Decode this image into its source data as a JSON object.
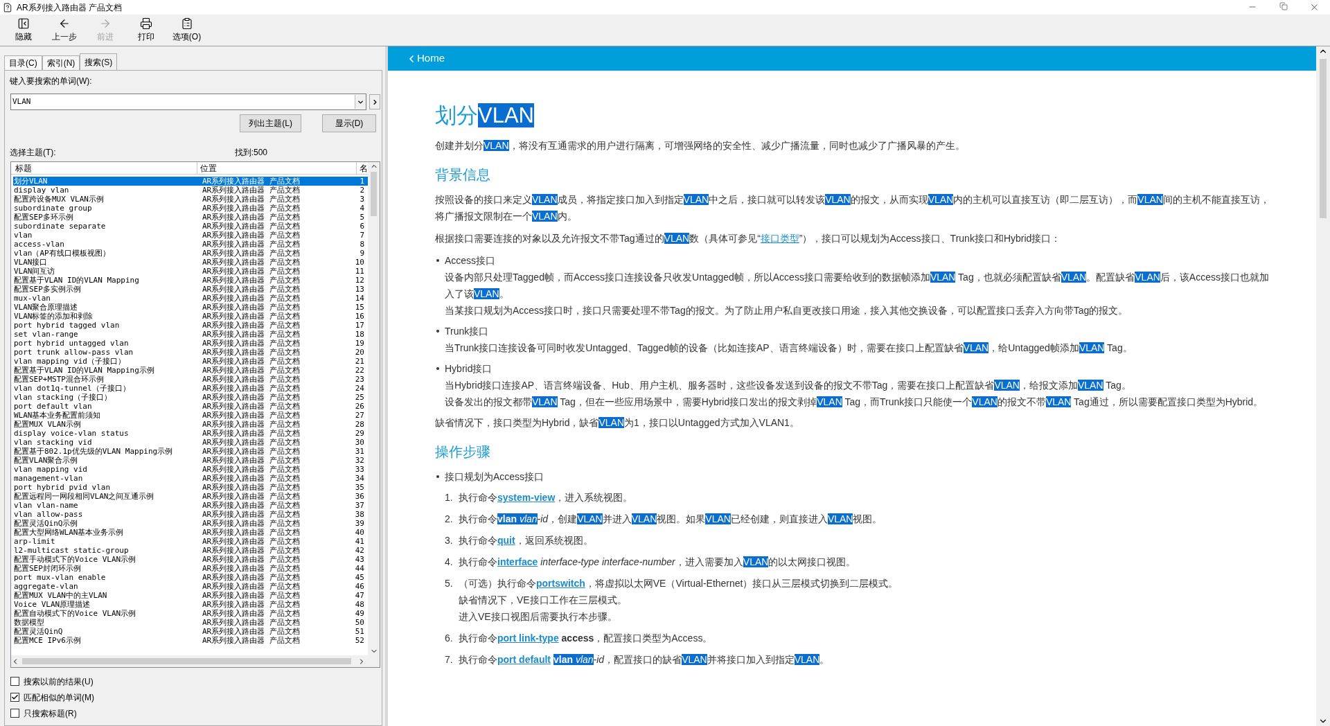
{
  "window": {
    "title": "AR系列接入路由器 产品文档"
  },
  "toolbar": [
    {
      "kind": "hide",
      "label": "隐藏",
      "disabled": false
    },
    {
      "kind": "back",
      "label": "上一步",
      "disabled": false
    },
    {
      "kind": "forward",
      "label": "前进",
      "disabled": true
    },
    {
      "kind": "print",
      "label": "打印",
      "disabled": false
    },
    {
      "kind": "options",
      "label": "选项(O)",
      "disabled": false
    }
  ],
  "tabs": [
    {
      "label": "目录(C)",
      "selected": false
    },
    {
      "label": "索引(N)",
      "selected": false
    },
    {
      "label": "搜索(S)",
      "selected": true
    }
  ],
  "search": {
    "label": "键入要搜索的单词(W):",
    "value": "VLAN"
  },
  "buttons": [
    "列出主题(L)",
    "显示(D)"
  ],
  "topics": {
    "label": "选择主题(T):",
    "found": "找到:500",
    "columns": [
      "标题",
      "位置",
      "名"
    ],
    "rows": [
      {
        "title": "划分VLAN",
        "location": "AR系列接入路由器 产品文档",
        "rank": "1",
        "selected": true
      },
      {
        "title": "display vlan",
        "location": "AR系列接入路由器 产品文档",
        "rank": "2",
        "selected": false
      },
      {
        "title": "配置跨设备MUX VLAN示例",
        "location": "AR系列接入路由器 产品文档",
        "rank": "3",
        "selected": false
      },
      {
        "title": "subordinate group",
        "location": "AR系列接入路由器 产品文档",
        "rank": "4",
        "selected": false
      },
      {
        "title": "配置SEP多环示例",
        "location": "AR系列接入路由器 产品文档",
        "rank": "5",
        "selected": false
      },
      {
        "title": "subordinate separate",
        "location": "AR系列接入路由器 产品文档",
        "rank": "6",
        "selected": false
      },
      {
        "title": "vlan",
        "location": "AR系列接入路由器 产品文档",
        "rank": "7",
        "selected": false
      },
      {
        "title": "access-vlan",
        "location": "AR系列接入路由器 产品文档",
        "rank": "8",
        "selected": false
      },
      {
        "title": "vlan（AP有线口模板视图）",
        "location": "AR系列接入路由器 产品文档",
        "rank": "9",
        "selected": false
      },
      {
        "title": "VLAN接口",
        "location": "AR系列接入路由器 产品文档",
        "rank": "10",
        "selected": false
      },
      {
        "title": "VLAN间互访",
        "location": "AR系列接入路由器 产品文档",
        "rank": "11",
        "selected": false
      },
      {
        "title": "配置基于VLAN ID的VLAN Mapping",
        "location": "AR系列接入路由器 产品文档",
        "rank": "12",
        "selected": false
      },
      {
        "title": "配置SEP多实例示例",
        "location": "AR系列接入路由器 产品文档",
        "rank": "13",
        "selected": false
      },
      {
        "title": "mux-vlan",
        "location": "AR系列接入路由器 产品文档",
        "rank": "14",
        "selected": false
      },
      {
        "title": "VLAN聚合原理描述",
        "location": "AR系列接入路由器 产品文档",
        "rank": "15",
        "selected": false
      },
      {
        "title": "VLAN标签的添加和剥除",
        "location": "AR系列接入路由器 产品文档",
        "rank": "16",
        "selected": false
      },
      {
        "title": "port hybrid tagged vlan",
        "location": "AR系列接入路由器 产品文档",
        "rank": "17",
        "selected": false
      },
      {
        "title": "set vlan-range",
        "location": "AR系列接入路由器 产品文档",
        "rank": "18",
        "selected": false
      },
      {
        "title": "port hybrid untagged vlan",
        "location": "AR系列接入路由器 产品文档",
        "rank": "19",
        "selected": false
      },
      {
        "title": "port trunk allow-pass vlan",
        "location": "AR系列接入路由器 产品文档",
        "rank": "20",
        "selected": false
      },
      {
        "title": "vlan mapping vid（子接口）",
        "location": "AR系列接入路由器 产品文档",
        "rank": "21",
        "selected": false
      },
      {
        "title": "配置基于VLAN ID的VLAN Mapping示例",
        "location": "AR系列接入路由器 产品文档",
        "rank": "22",
        "selected": false
      },
      {
        "title": "配置SEP+MSTP混合环示例",
        "location": "AR系列接入路由器 产品文档",
        "rank": "23",
        "selected": false
      },
      {
        "title": "vlan dot1q-tunnel（子接口）",
        "location": "AR系列接入路由器 产品文档",
        "rank": "24",
        "selected": false
      },
      {
        "title": "vlan stacking（子接口）",
        "location": "AR系列接入路由器 产品文档",
        "rank": "25",
        "selected": false
      },
      {
        "title": "port default vlan",
        "location": "AR系列接入路由器 产品文档",
        "rank": "26",
        "selected": false
      },
      {
        "title": "WLAN基本业务配置前须知",
        "location": "AR系列接入路由器 产品文档",
        "rank": "27",
        "selected": false
      },
      {
        "title": "配置MUX VLAN示例",
        "location": "AR系列接入路由器 产品文档",
        "rank": "28",
        "selected": false
      },
      {
        "title": "display voice-vlan status",
        "location": "AR系列接入路由器 产品文档",
        "rank": "29",
        "selected": false
      },
      {
        "title": "vlan stacking vid",
        "location": "AR系列接入路由器 产品文档",
        "rank": "30",
        "selected": false
      },
      {
        "title": "配置基于802.1p优先级的VLAN Mapping示例",
        "location": "AR系列接入路由器 产品文档",
        "rank": "31",
        "selected": false
      },
      {
        "title": "配置VLAN聚合示例",
        "location": "AR系列接入路由器 产品文档",
        "rank": "32",
        "selected": false
      },
      {
        "title": "vlan mapping vid",
        "location": "AR系列接入路由器 产品文档",
        "rank": "33",
        "selected": false
      },
      {
        "title": "management-vlan",
        "location": "AR系列接入路由器 产品文档",
        "rank": "34",
        "selected": false
      },
      {
        "title": "port hybrid pvid vlan",
        "location": "AR系列接入路由器 产品文档",
        "rank": "35",
        "selected": false
      },
      {
        "title": "配置远程同一网段相同VLAN之间互通示例",
        "location": "AR系列接入路由器 产品文档",
        "rank": "36",
        "selected": false
      },
      {
        "title": "vlan vlan-name",
        "location": "AR系列接入路由器 产品文档",
        "rank": "37",
        "selected": false
      },
      {
        "title": "vlan allow-pass",
        "location": "AR系列接入路由器 产品文档",
        "rank": "38",
        "selected": false
      },
      {
        "title": "配置灵活QinQ示例",
        "location": "AR系列接入路由器 产品文档",
        "rank": "39",
        "selected": false
      },
      {
        "title": "配置大型网络WLAN基本业务示例",
        "location": "AR系列接入路由器 产品文档",
        "rank": "40",
        "selected": false
      },
      {
        "title": "arp-limit",
        "location": "AR系列接入路由器 产品文档",
        "rank": "41",
        "selected": false
      },
      {
        "title": "l2-multicast static-group",
        "location": "AR系列接入路由器 产品文档",
        "rank": "42",
        "selected": false
      },
      {
        "title": "配置手动模式下的Voice VLAN示例",
        "location": "AR系列接入路由器 产品文档",
        "rank": "43",
        "selected": false
      },
      {
        "title": "配置SEP封闭环示例",
        "location": "AR系列接入路由器 产品文档",
        "rank": "44",
        "selected": false
      },
      {
        "title": "port mux-vlan enable",
        "location": "AR系列接入路由器 产品文档",
        "rank": "45",
        "selected": false
      },
      {
        "title": "aggregate-vlan",
        "location": "AR系列接入路由器 产品文档",
        "rank": "46",
        "selected": false
      },
      {
        "title": "配置MUX VLAN中的主VLAN",
        "location": "AR系列接入路由器 产品文档",
        "rank": "47",
        "selected": false
      },
      {
        "title": "Voice VLAN原理描述",
        "location": "AR系列接入路由器 产品文档",
        "rank": "48",
        "selected": false
      },
      {
        "title": "配置自动模式下的Voice VLAN示例",
        "location": "AR系列接入路由器 产品文档",
        "rank": "49",
        "selected": false
      },
      {
        "title": "数据模型",
        "location": "AR系列接入路由器 产品文档",
        "rank": "50",
        "selected": false
      },
      {
        "title": "配置灵活QinQ",
        "location": "AR系列接入路由器 产品文档",
        "rank": "51",
        "selected": false
      },
      {
        "title": "配置MCE IPv6示例",
        "location": "AR系列接入路由器 产品文档",
        "rank": "52",
        "selected": false
      }
    ]
  },
  "options": [
    {
      "label": "搜索以前的结果(U)",
      "checked": false
    },
    {
      "label": "匹配相似的单词(M)",
      "checked": true
    },
    {
      "label": "只搜索标题(R)",
      "checked": false
    }
  ],
  "content": {
    "back": "Home",
    "title": [
      {
        "kind": "text",
        "text": "划分"
      },
      {
        "kind": "hit",
        "text": "VLAN"
      }
    ],
    "blocks": [
      {
        "kind": "p",
        "runs": [
          {
            "kind": "text",
            "text": "创建并划分"
          },
          {
            "kind": "hit",
            "text": "VLAN"
          },
          {
            "kind": "text",
            "text": "，将没有互通需求的用户进行隔离，可增强网络的安全性、减少广播流量，同时也减少了广播风暴的产生。"
          }
        ]
      },
      {
        "kind": "h2",
        "text": "背景信息"
      },
      {
        "kind": "p",
        "runs": [
          {
            "kind": "text",
            "text": "按照设备的接口来定义"
          },
          {
            "kind": "hit",
            "text": "VLAN"
          },
          {
            "kind": "text",
            "text": "成员，将指定接口加入到指定"
          },
          {
            "kind": "hit",
            "text": "VLAN"
          },
          {
            "kind": "text",
            "text": "中之后，接口就可以转发该"
          },
          {
            "kind": "hit",
            "text": "VLAN"
          },
          {
            "kind": "text",
            "text": "的报文，从而实现"
          },
          {
            "kind": "hit",
            "text": "VLAN"
          },
          {
            "kind": "text",
            "text": "内的主机可以直接互访（即二层互访），而"
          },
          {
            "kind": "hit",
            "text": "VLAN"
          },
          {
            "kind": "text",
            "text": "间的主机不能直接互访，将广播报文限制在一个"
          },
          {
            "kind": "hit",
            "text": "VLAN"
          },
          {
            "kind": "text",
            "text": "内。"
          }
        ]
      },
      {
        "kind": "p",
        "runs": [
          {
            "kind": "text",
            "text": "根据接口需要连接的对象以及允许报文不带Tag通过的"
          },
          {
            "kind": "hit",
            "text": "VLAN"
          },
          {
            "kind": "text",
            "text": "数（具体可参见“"
          },
          {
            "kind": "link",
            "text": "接口类型"
          },
          {
            "kind": "text",
            "text": "”），接口可以规划为Access接口、Trunk接口和Hybrid接口："
          }
        ]
      },
      {
        "kind": "bullet",
        "text": "Access接口",
        "lines": [
          [
            {
              "kind": "text",
              "text": "设备内部只处理Tagged帧，而Access接口连接设备只收发Untagged帧，所以Access接口需要给收到的数据帧添加"
            },
            {
              "kind": "hit",
              "text": "VLAN"
            },
            {
              "kind": "text",
              "text": " Tag，也就必须配置缺省"
            },
            {
              "kind": "hit",
              "text": "VLAN"
            },
            {
              "kind": "text",
              "text": "。配置缺省"
            },
            {
              "kind": "hit",
              "text": "VLAN"
            },
            {
              "kind": "text",
              "text": "后，该Access接口也就加入了该"
            },
            {
              "kind": "hit",
              "text": "VLAN"
            },
            {
              "kind": "text",
              "text": "。"
            }
          ],
          [
            {
              "kind": "text",
              "text": "当某接口规划为Access接口时，接口只需要处理不带Tag的报文。为了防止用户私自更改接口用途，接入其他交换设备，可以配置接口丢弃入方向带Tag的报文。"
            }
          ]
        ]
      },
      {
        "kind": "bullet",
        "text": "Trunk接口",
        "lines": [
          [
            {
              "kind": "text",
              "text": "当Trunk接口连接设备可同时收发Untagged、Tagged帧的设备（比如连接AP、语言终端设备）时，需要在接口上配置缺省"
            },
            {
              "kind": "hit",
              "text": "VLAN"
            },
            {
              "kind": "text",
              "text": "，给Untagged帧添加"
            },
            {
              "kind": "hit",
              "text": "VLAN"
            },
            {
              "kind": "text",
              "text": " Tag。"
            }
          ]
        ]
      },
      {
        "kind": "bullet",
        "text": "Hybrid接口",
        "lines": [
          [
            {
              "kind": "text",
              "text": "当Hybrid接口连接AP、语言终端设备、Hub、用户主机、服务器时，这些设备发送到设备的报文不带Tag，需要在接口上配置缺省"
            },
            {
              "kind": "hit",
              "text": "VLAN"
            },
            {
              "kind": "text",
              "text": "，给报文添加"
            },
            {
              "kind": "hit",
              "text": "VLAN"
            },
            {
              "kind": "text",
              "text": " Tag。"
            }
          ],
          [
            {
              "kind": "text",
              "text": "设备发出的报文都带"
            },
            {
              "kind": "hit",
              "text": "VLAN"
            },
            {
              "kind": "text",
              "text": " Tag，但在一些应用场景中，需要Hybrid接口发出的报文剥掉"
            },
            {
              "kind": "hit",
              "text": "VLAN"
            },
            {
              "kind": "text",
              "text": " Tag，而Trunk接口只能使一个"
            },
            {
              "kind": "hit",
              "text": "VLAN"
            },
            {
              "kind": "text",
              "text": "的报文不带"
            },
            {
              "kind": "hit",
              "text": "VLAN"
            },
            {
              "kind": "text",
              "text": " Tag通过，所以需要配置接口类型为Hybrid。"
            }
          ]
        ]
      },
      {
        "kind": "p",
        "runs": [
          {
            "kind": "text",
            "text": "缺省情况下，接口类型为Hybrid，缺省"
          },
          {
            "kind": "hit",
            "text": "VLAN"
          },
          {
            "kind": "text",
            "text": "为1，接口以Untagged方式加入VLAN1。"
          }
        ]
      },
      {
        "kind": "h2",
        "text": "操作步骤"
      },
      {
        "kind": "bullet",
        "text": "接口规划为Access接口"
      },
      {
        "kind": "step",
        "number": "1.",
        "lines": [
          [
            {
              "kind": "text",
              "text": "执行命令"
            },
            {
              "kind": "cmdlink",
              "text": "system-view"
            },
            {
              "kind": "text",
              "text": "，进入系统视图。"
            }
          ]
        ]
      },
      {
        "kind": "step",
        "number": "2.",
        "lines": [
          [
            {
              "kind": "text",
              "text": "执行命令"
            },
            {
              "kind": "hit_cmd",
              "text": "vlan "
            },
            {
              "kind": "hit_arg",
              "text": "vlan"
            },
            {
              "kind": "arg",
              "text": "-id"
            },
            {
              "kind": "text",
              "text": "，创建"
            },
            {
              "kind": "hit",
              "text": "VLAN"
            },
            {
              "kind": "text",
              "text": "并进入"
            },
            {
              "kind": "hit",
              "text": "VLAN"
            },
            {
              "kind": "text",
              "text": "视图。如果"
            },
            {
              "kind": "hit",
              "text": "VLAN"
            },
            {
              "kind": "text",
              "text": "已经创建，则直接进入"
            },
            {
              "kind": "hit",
              "text": "VLAN"
            },
            {
              "kind": "text",
              "text": "视图。"
            }
          ]
        ]
      },
      {
        "kind": "step",
        "number": "3.",
        "lines": [
          [
            {
              "kind": "text",
              "text": "执行命令"
            },
            {
              "kind": "cmdlink",
              "text": "quit"
            },
            {
              "kind": "text",
              "text": "，返回系统视图。"
            }
          ]
        ]
      },
      {
        "kind": "step",
        "number": "4.",
        "lines": [
          [
            {
              "kind": "text",
              "text": "执行命令"
            },
            {
              "kind": "cmdlink",
              "text": "interface"
            },
            {
              "kind": "arg",
              "text": " interface-type interface-number"
            },
            {
              "kind": "text",
              "text": "，进入需要加入"
            },
            {
              "kind": "hit",
              "text": "VLAN"
            },
            {
              "kind": "text",
              "text": "的以太网接口视图。"
            }
          ]
        ]
      },
      {
        "kind": "step",
        "number": "5.",
        "lines": [
          [
            {
              "kind": "text",
              "text": "（可选）执行命令"
            },
            {
              "kind": "cmdlink",
              "text": "portswitch"
            },
            {
              "kind": "text",
              "text": "，将虚拟以太网VE（Virtual-Ethernet）接口从三层模式切换到二层模式。"
            }
          ],
          [
            {
              "kind": "text",
              "text": "缺省情况下，VE接口工作在三层模式。"
            }
          ],
          [
            {
              "kind": "text",
              "text": "进入VE接口视图后需要执行本步骤。"
            }
          ]
        ]
      },
      {
        "kind": "step",
        "number": "6.",
        "lines": [
          [
            {
              "kind": "text",
              "text": "执行命令"
            },
            {
              "kind": "cmdlink",
              "text": "port link-type"
            },
            {
              "kind": "cmd",
              "text": " access"
            },
            {
              "kind": "text",
              "text": "，配置接口类型为Access。"
            }
          ]
        ]
      },
      {
        "kind": "step",
        "number": "7.",
        "lines": [
          [
            {
              "kind": "text",
              "text": "执行命令"
            },
            {
              "kind": "cmdlink",
              "text": "port default"
            },
            {
              "kind": "hit_cmd",
              "text": "vlan ",
              "spaced": true
            },
            {
              "kind": "hit_arg",
              "text": "vlan"
            },
            {
              "kind": "arg",
              "text": "-id"
            },
            {
              "kind": "text",
              "text": "，配置接口的缺省"
            },
            {
              "kind": "hit",
              "text": "VLAN"
            },
            {
              "kind": "text",
              "text": "并将接口加入到指定"
            },
            {
              "kind": "hit",
              "text": "VLAN"
            },
            {
              "kind": "text",
              "text": "。"
            }
          ]
        ]
      }
    ]
  }
}
